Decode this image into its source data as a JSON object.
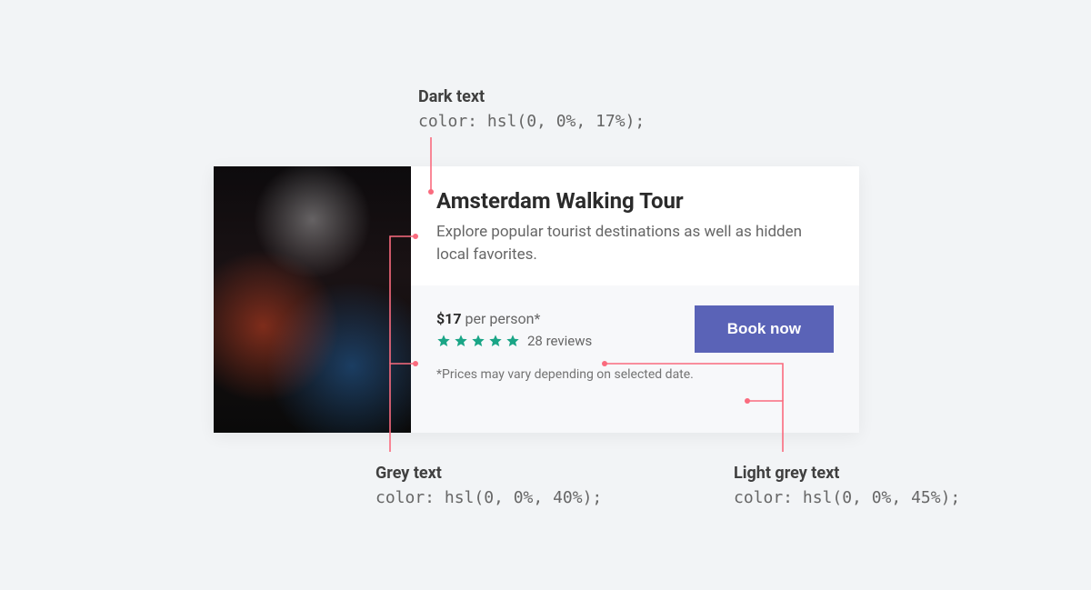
{
  "annotations": {
    "dark": {
      "label": "Dark text",
      "code": "color: hsl(0, 0%, 17%);"
    },
    "grey": {
      "label": "Grey text",
      "code": "color: hsl(0, 0%, 40%);"
    },
    "light": {
      "label": "Light grey text",
      "code": "color: hsl(0, 0%, 45%);"
    }
  },
  "card": {
    "title": "Amsterdam Walking Tour",
    "description": "Explore popular tourist destinations as well as hidden local favorites.",
    "price": {
      "amount": "$17",
      "unit": "per person*"
    },
    "reviews": {
      "stars": 5,
      "count_text": "28 reviews"
    },
    "book_label": "Book now",
    "disclaimer": "*Prices may vary depending on selected date."
  },
  "colors": {
    "star": "#1aa586",
    "button": "#5a63b7",
    "leader": "#fa6b7e"
  }
}
